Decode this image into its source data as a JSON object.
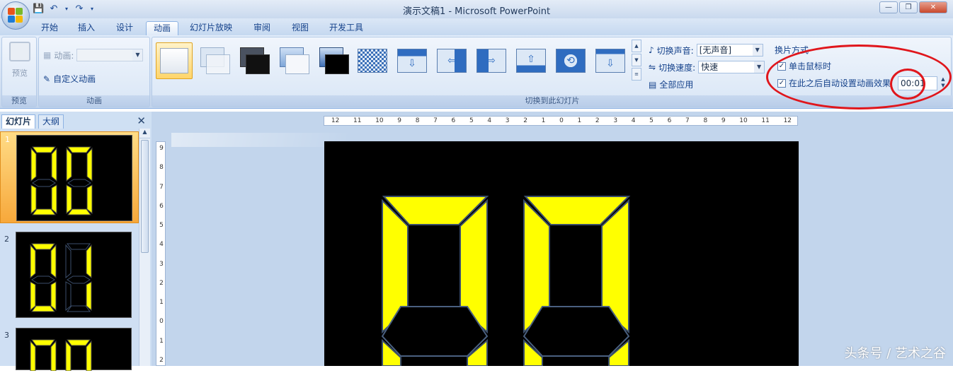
{
  "window": {
    "title": "演示文稿1 - Microsoft PowerPoint",
    "controls": [
      "—",
      "❐",
      "✕"
    ]
  },
  "tabs": [
    "开始",
    "插入",
    "设计",
    "动画",
    "幻灯片放映",
    "审阅",
    "视图",
    "开发工具"
  ],
  "active_tab": "动画",
  "ribbon": {
    "preview_group": {
      "button_label": "预览",
      "group_label": "预览"
    },
    "animation_group": {
      "animation_label": "动画:",
      "custom_animation": "自定义动画",
      "group_label": "动画"
    },
    "transition_group": {
      "group_label": "切换到此幻灯片",
      "sound_label": "切换声音:",
      "sound_value": "[无声音]",
      "speed_label": "切换速度:",
      "speed_value": "快速",
      "apply_all": "全部应用"
    },
    "advance_group": {
      "title": "换片方式",
      "on_click_label": "单击鼠标时",
      "auto_label": "在此之后自动设置动画效果",
      "auto_time": "00:01"
    }
  },
  "side_panel": {
    "tab_slides": "幻灯片",
    "tab_outline": "大纲",
    "slide_numbers": [
      "1",
      "2",
      "3"
    ]
  },
  "ruler": {
    "h_labels": [
      "12",
      "11",
      "10",
      "9",
      "8",
      "7",
      "6",
      "5",
      "4",
      "3",
      "2",
      "1",
      "0",
      "1",
      "2",
      "3",
      "4",
      "5",
      "6",
      "7",
      "8",
      "9",
      "10",
      "11",
      "12"
    ],
    "v_labels": [
      "9",
      "8",
      "7",
      "6",
      "5",
      "4",
      "3",
      "2",
      "1",
      "0",
      "1",
      "2"
    ]
  },
  "slide_content": {
    "digits": [
      "0",
      "0"
    ],
    "digit_color": "#ffff00",
    "background": "#000000"
  },
  "annotation": {
    "color": "#e0161c"
  },
  "watermark": "头条号 / 艺术之谷",
  "colors": {
    "tab_text": "#15428b",
    "ribbon_bg": "#d9e6f6",
    "active_thumb": "#ffd56b"
  }
}
